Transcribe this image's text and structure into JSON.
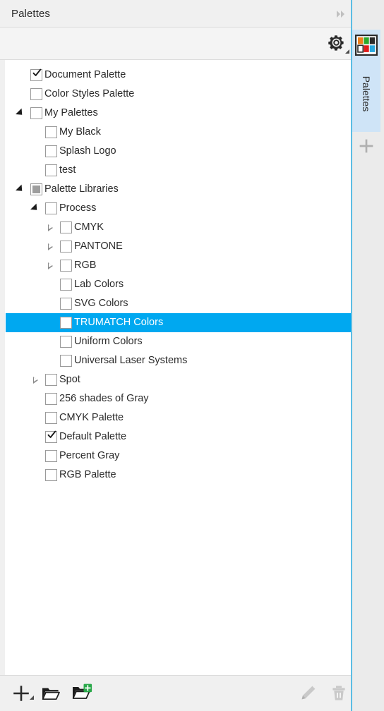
{
  "panel": {
    "title": "Palettes",
    "collapse_icon": "double-chevron-right-icon",
    "close_icon": "close-x-icon"
  },
  "toolstrip": {
    "options_icon": "gear-icon",
    "options_has_dropdown": true
  },
  "tree": {
    "items": [
      {
        "label": "Document Palette",
        "level": 0,
        "check": "checked",
        "expander": "none"
      },
      {
        "label": "Color Styles Palette",
        "level": 0,
        "check": "unchecked",
        "expander": "none"
      },
      {
        "label": "My Palettes",
        "level": 0,
        "check": "unchecked",
        "expander": "open"
      },
      {
        "label": "My Black",
        "level": 1,
        "check": "unchecked",
        "expander": "none"
      },
      {
        "label": "Splash Logo",
        "level": 1,
        "check": "unchecked",
        "expander": "none"
      },
      {
        "label": "test",
        "level": 1,
        "check": "unchecked",
        "expander": "none"
      },
      {
        "label": "Palette Libraries",
        "level": 0,
        "check": "partial",
        "expander": "open"
      },
      {
        "label": "Process",
        "level": 1,
        "check": "unchecked",
        "expander": "open"
      },
      {
        "label": "CMYK",
        "level": 2,
        "check": "unchecked",
        "expander": "closed"
      },
      {
        "label": "PANTONE",
        "level": 2,
        "check": "unchecked",
        "expander": "closed"
      },
      {
        "label": "RGB",
        "level": 2,
        "check": "unchecked",
        "expander": "closed"
      },
      {
        "label": "Lab Colors",
        "level": 2,
        "check": "unchecked",
        "expander": "none"
      },
      {
        "label": "SVG Colors",
        "level": 2,
        "check": "unchecked",
        "expander": "none"
      },
      {
        "label": "TRUMATCH Colors",
        "level": 2,
        "check": "unchecked",
        "expander": "none",
        "selected": true
      },
      {
        "label": "Uniform Colors",
        "level": 2,
        "check": "unchecked",
        "expander": "none"
      },
      {
        "label": "Universal Laser Systems",
        "level": 2,
        "check": "unchecked",
        "expander": "none"
      },
      {
        "label": "Spot",
        "level": 1,
        "check": "unchecked",
        "expander": "closed"
      },
      {
        "label": "256 shades of Gray",
        "level": 1,
        "check": "unchecked",
        "expander": "none"
      },
      {
        "label": "CMYK Palette",
        "level": 1,
        "check": "unchecked",
        "expander": "none"
      },
      {
        "label": "Default Palette",
        "level": 1,
        "check": "checked",
        "expander": "none"
      },
      {
        "label": "Percent Gray",
        "level": 1,
        "check": "unchecked",
        "expander": "none"
      },
      {
        "label": "RGB Palette",
        "level": 1,
        "check": "unchecked",
        "expander": "none"
      }
    ]
  },
  "bottombar": {
    "new_palette_icon": "plus-icon",
    "open_palette_icon": "open-folder-icon",
    "new_from_document_icon": "folder-add-icon",
    "edit_icon": "pencil-icon",
    "delete_icon": "trash-icon",
    "edit_enabled": false,
    "delete_enabled": false
  },
  "dock": {
    "tab_label": "Palettes",
    "tab_icon": "color-palette-grid-icon",
    "add_docker_icon": "plus-icon",
    "swatches": [
      "#ef7f1a",
      "#2aa82a",
      "#2b2b2b",
      "#ffffff",
      "#e01b1b",
      "#29a8e0"
    ]
  },
  "colors": {
    "selection": "#00a8f0",
    "accent_line": "#5bbde4",
    "tab_active": "#cfe4f7",
    "panel_bg": "#f0f0f0"
  }
}
